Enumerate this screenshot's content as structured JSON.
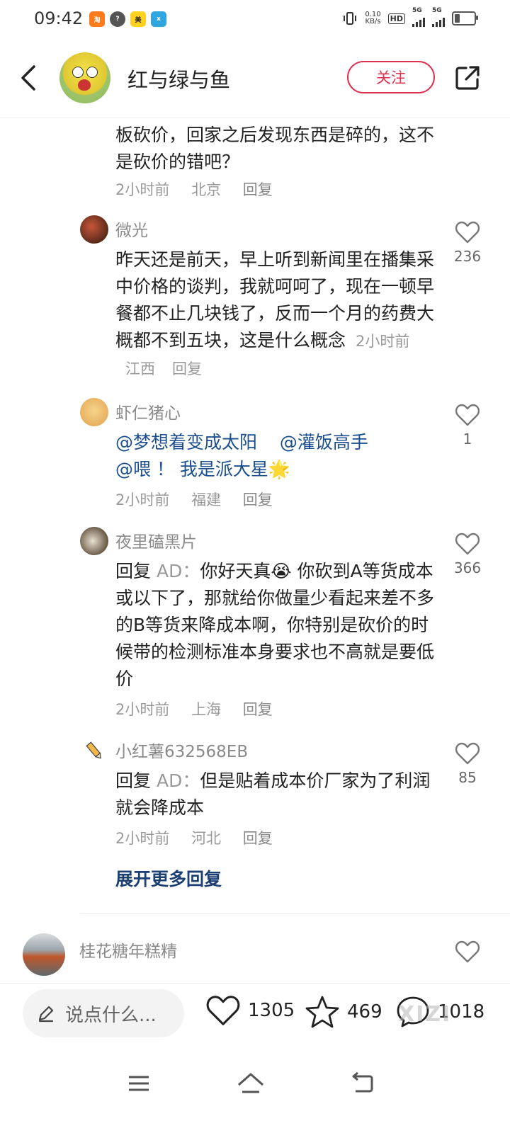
{
  "status_bar": {
    "time": "09:42",
    "net_speed_value": "0.10",
    "net_speed_unit": "KB/s",
    "hd_label": "HD",
    "sim1_label": "5G",
    "sim2_label": "5G",
    "notification_icons": [
      "taobao-icon",
      "browser-icon",
      "meituan-icon",
      "xianyu-icon"
    ]
  },
  "header": {
    "title": "红与绿与鱼",
    "follow_label": "关注"
  },
  "comments": [
    {
      "id": "partial",
      "text": "板砍价，回家之后发现东西是碎的，这不是砍价的错吧？",
      "time": "2小时前",
      "location": "北京",
      "reply_label": "回复"
    },
    {
      "id": "weiguang",
      "user": "微光",
      "text": "昨天还是前天，早上听到新闻里在播集采中价格的谈判，我就呵呵了，现在一顿早餐都不止几块钱了，反而一个月的药费大概都不到五块，这是什么概念",
      "time": "2小时前",
      "location": "江西",
      "reply_label": "回复",
      "likes": "236"
    },
    {
      "id": "xiarenzhuxin",
      "user": "虾仁猪心",
      "mentions": [
        "@梦想着变成太阳",
        "@灌饭高手",
        "@喂 ！ 我是派大星"
      ],
      "emoji": "🌟",
      "time": "2小时前",
      "location": "福建",
      "reply_label": "回复",
      "likes": "1"
    },
    {
      "id": "yeliqiheipian",
      "user": "夜里磕黑片",
      "reply_prefix": "回复",
      "reply_target": "AD：",
      "emoji": "😭",
      "text_before": "你好天真",
      "text_after": "你砍到A等货成本或以下了，那就给你做量少看起来差不多的B等货来降成本啊，你特别是砍价的时候带的检测标准本身要求也不高就是要低价",
      "time": "2小时前",
      "location": "上海",
      "reply_label": "回复",
      "likes": "366"
    },
    {
      "id": "xiaohongshu",
      "user": "小红薯632568EB",
      "reply_prefix": "回复",
      "reply_target": "AD：",
      "text": "但是贴着成本价厂家为了利润就会降成本",
      "time": "2小时前",
      "location": "河北",
      "reply_label": "回复",
      "likes": "85"
    },
    {
      "id": "guihua",
      "user": "桂花糖年糕精"
    }
  ],
  "expand_more_label": "展开更多回复",
  "bottom_bar": {
    "input_placeholder": "说点什么...",
    "likes": "1305",
    "stars": "469",
    "comments": "1018",
    "watermark": "XIZI"
  },
  "colors": {
    "accent_red": "#e0304e",
    "mention_blue": "#1b4e8e",
    "muted_gray": "#999999"
  }
}
